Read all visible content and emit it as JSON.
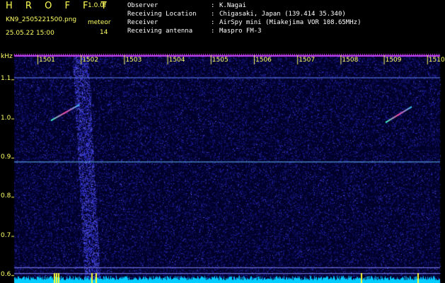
{
  "header": {
    "app_title": "H R O F F T",
    "version": "1.0.0f",
    "filename": "KN9_2505221500.png",
    "datetime": "25.05.22 15:00",
    "meteor_label": "meteor",
    "meteor_count": "14"
  },
  "info": [
    {
      "key": "Observer",
      "sep": ":",
      "value": "K.Nagai"
    },
    {
      "key": "Receiving Location",
      "sep": ":",
      "value": "Chigasaki, Japan (139.414 35.340)"
    },
    {
      "key": "Receiver",
      "sep": ":",
      "value": "AirSpy mini (Miakejima VOR 108.65MHz)"
    },
    {
      "key": "Receiving antenna",
      "sep": ":",
      "value": "Maspro FM-3"
    }
  ],
  "chart_data": {
    "type": "heatmap",
    "ylabel": "kHz",
    "ylim": [
      0.58,
      1.16
    ],
    "y_ticks": [
      "1.1",
      "1.0",
      "0.9",
      "0.8",
      "0.7",
      "0.6"
    ],
    "x_ticks": [
      "1501",
      "1502",
      "1503",
      "1504",
      "1505",
      "1506",
      "1507",
      "1508",
      "1509",
      "1510"
    ],
    "colors": {
      "background": "#000033",
      "noise": "#1a1a9a",
      "signal": "#00ccff",
      "meteor": "#ff44aa",
      "header_strip": "#cc44ff"
    }
  }
}
